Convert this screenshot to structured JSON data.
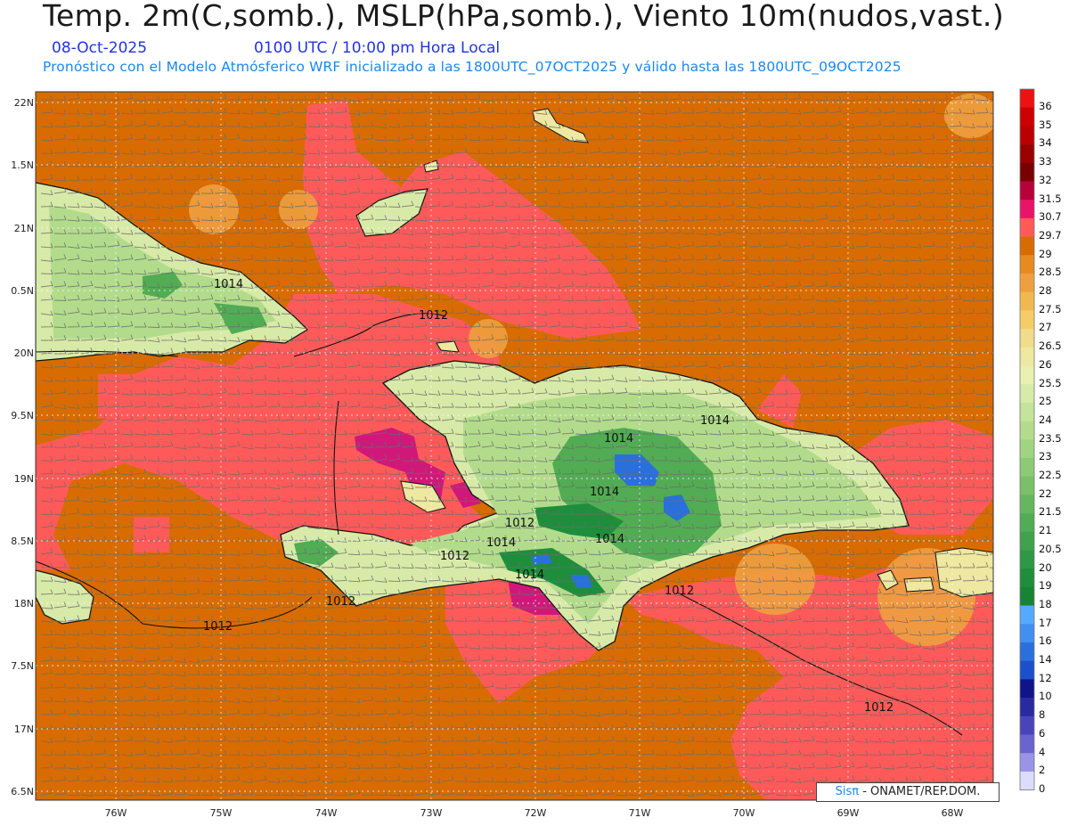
{
  "header": {
    "title": "Temp. 2m(C,somb.), MSLP(hPa,somb.), Viento 10m(nudos,vast.)",
    "date": "08-Oct-2025",
    "time": "0100 UTC / 10:00 pm Hora Local",
    "subtitle": "Pronóstico con el Modelo Atmósferico WRF inicializado a las 1800UTC_07OCT2025 y válido hasta las  1800UTC_09OCT2025"
  },
  "axes": {
    "lat_labels": [
      "22N",
      "1.5N",
      "21N",
      "0.5N",
      "20N",
      "9.5N",
      "19N",
      "8.5N",
      "18N",
      "7.5N",
      "17N",
      "6.5N"
    ],
    "lon_labels": [
      "76W",
      "75W",
      "74W",
      "73W",
      "72W",
      "71W",
      "70W",
      "69W",
      "68W"
    ]
  },
  "colorbar": {
    "levels": [
      "36",
      "35",
      "34",
      "33",
      "32",
      "31.5",
      "30.7",
      "29.7",
      "29",
      "28.5",
      "28",
      "27.5",
      "27",
      "26.5",
      "26",
      "25.5",
      "25",
      "24",
      "23.5",
      "23",
      "22.5",
      "22",
      "21.5",
      "21",
      "20.5",
      "20",
      "19",
      "18",
      "17",
      "16",
      "14",
      "12",
      "10",
      "8",
      "6",
      "4",
      "2",
      "0"
    ],
    "colors": [
      "#ee1111",
      "#cc0000",
      "#bb0000",
      "#990000",
      "#7a0000",
      "#b8003a",
      "#e8146a",
      "#ff5a5a",
      "#d86c00",
      "#e88a20",
      "#eea040",
      "#f2b850",
      "#f6cc66",
      "#f0dc8a",
      "#eee8a0",
      "#eaf0b0",
      "#d8eaa8",
      "#c4e49a",
      "#b2dc8c",
      "#a0d480",
      "#8cca74",
      "#7ac068",
      "#66b65e",
      "#52ac54",
      "#40a24c",
      "#2e9844",
      "#1e8e3c",
      "#168434",
      "#55aaff",
      "#3f90f0",
      "#2a70dd",
      "#1a50cc",
      "#10148a",
      "#2a2aa0",
      "#4a44bb",
      "#6a64d0",
      "#9a94e8",
      "#dcdcfc"
    ]
  },
  "map": {
    "colors": {
      "sea_warm": "#d86c00",
      "sea_hot": "#ff5a5a",
      "hot_spot": "#d0187a",
      "land_warm": "#eee8a0",
      "land_mild": "#b2dc8c",
      "land_cool": "#52ac54",
      "land_cold": "#2a70dd"
    },
    "isobars": [
      "1014",
      "1012",
      "1012",
      "1014",
      "1014",
      "1014",
      "1014",
      "1012",
      "1014",
      "1014",
      "1012",
      "1012",
      "1012",
      "1012"
    ]
  },
  "credit": {
    "brand": "Sisπ",
    "text": " - ONAMET/REP.DOM."
  }
}
